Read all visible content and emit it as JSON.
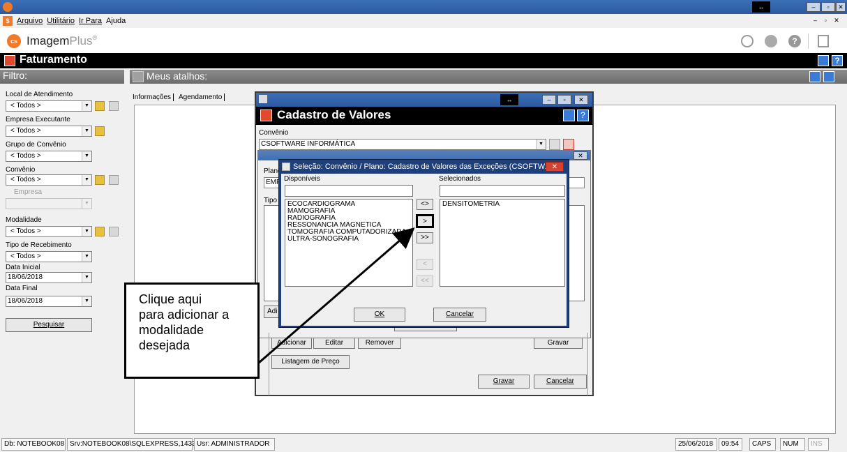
{
  "menu": {
    "items": [
      "Arquivo",
      "Utilitário",
      "Ir Para",
      "Ajuda"
    ]
  },
  "logo": {
    "text_main": "Imagem",
    "text_plus": "Plus",
    "reg": "®",
    "badge": "cs"
  },
  "module": {
    "title": "Faturamento"
  },
  "filter": {
    "header": "Filtro:",
    "local_label": "Local de Atendimento",
    "local_value": "< Todos >",
    "empresa_exec_label": "Empresa Executante",
    "empresa_exec_value": "< Todos >",
    "grupo_label": "Grupo de Convênio",
    "grupo_value": "< Todos >",
    "convenio_label": "Convênio",
    "convenio_value": "< Todos >",
    "empresa_label": "Empresa",
    "empresa_value": "",
    "modalidade_label": "Modalidade",
    "modalidade_value": "< Todos >",
    "tipo_receb_label": "Tipo de Recebimento",
    "tipo_receb_value": "< Todos >",
    "data_inicial_label": "Data Inicial",
    "data_inicial_value": "18/06/2018",
    "data_final_label": "Data Final",
    "data_final_value": "18/06/2018",
    "search_button": "Pesquisar"
  },
  "shortcuts": {
    "header": "Meus atalhos:",
    "tab_info": "Informações",
    "tab_agenda": "Agendamento"
  },
  "cadastro": {
    "title": "Cadastro de Valores",
    "convenio_label": "Convênio",
    "convenio_value": "CSOFTWARE INFORMÁTICA",
    "plano_label": "Plano",
    "plano_value": "EMP",
    "tipo_label": "Tipo",
    "add_btn_partial": "Adi",
    "fechar_partial": "Fechar",
    "adicionar": "Adicionar",
    "editar": "Editar",
    "remover": "Remover",
    "gravar_inner": "Gravar",
    "listagem": "Listagem de Preço",
    "gravar": "Gravar",
    "cancelar": "Cancelar"
  },
  "selecao": {
    "title": "Seleção: Convênio / Plano: Cadastro de Valores das Exceções (CSOFTW...",
    "disponiveis_label": "Disponíveis",
    "selecionados_label": "Selecionados",
    "disponiveis": [
      "ECOCARDIOGRAMA",
      "MAMOGRAFIA",
      "RADIOGRAFIA",
      "RESSONANCIA MAGNETICA",
      "TOMOGRAFIA COMPUTADORIZADA",
      "ULTRA-SONOGRAFIA"
    ],
    "selecionados": [
      "DENSITOMETRIA"
    ],
    "btn_swap": "<>",
    "btn_add": ">",
    "btn_add_all": ">>",
    "btn_remove": "<",
    "btn_remove_all": "<<",
    "ok": "OK",
    "cancelar": "Cancelar"
  },
  "callout": {
    "lines": [
      "Clique aqui",
      "para adicionar a",
      "modalidade",
      "desejada"
    ]
  },
  "status": {
    "db": "Db: NOTEBOOK08",
    "srv": "Srv:NOTEBOOK08\\SQLEXPRESS,1433",
    "usr": "Usr: ADMINISTRADOR",
    "date": "25/06/2018",
    "time": "09:54",
    "caps": "CAPS",
    "num": "NUM",
    "ins": "INS"
  },
  "colors": {
    "title_blue": "#2d5aa0",
    "black_header": "#000000",
    "red_icon": "#e04a2a",
    "logo_orange": "#f07a2a"
  }
}
